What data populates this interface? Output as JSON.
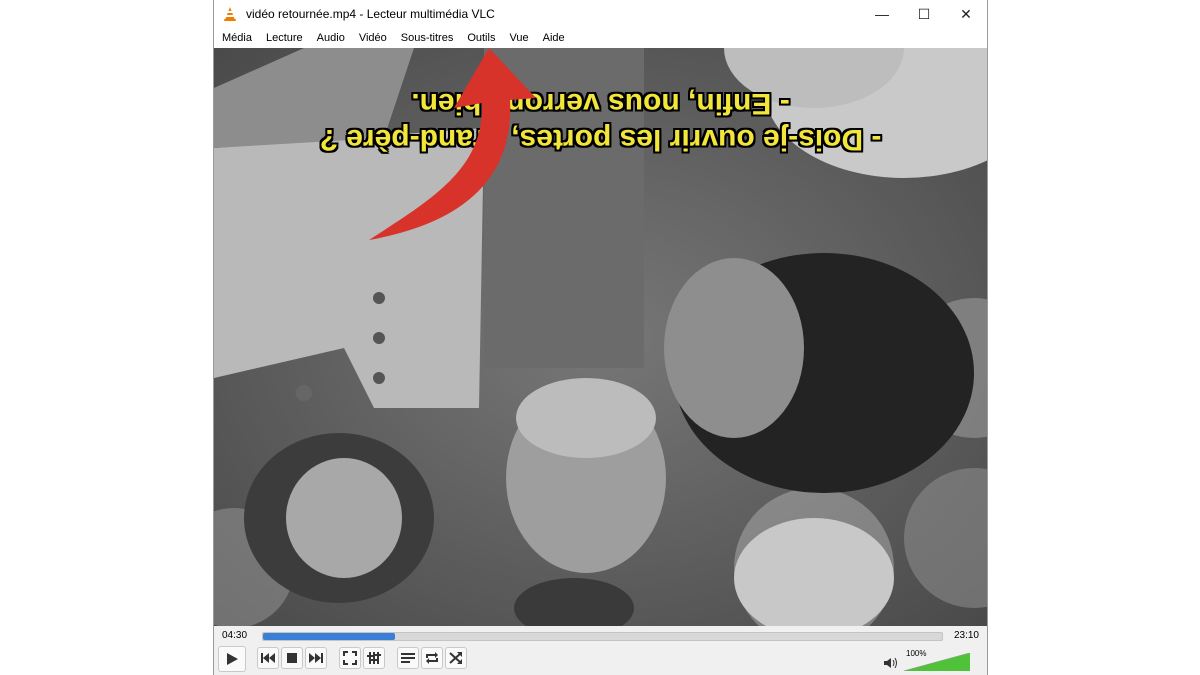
{
  "window": {
    "title": "vidéo retournée.mp4 - Lecteur multimédia VLC",
    "minimize_glyph": "—",
    "maximize_glyph": "☐",
    "close_glyph": "✕"
  },
  "menu": {
    "items": [
      "Média",
      "Lecture",
      "Audio",
      "Vidéo",
      "Sous-titres",
      "Outils",
      "Vue",
      "Aide"
    ]
  },
  "video": {
    "subtitle_line1": "- Dois-je ouvrir les portes, grand-père ?",
    "subtitle_line2": "- Enfin, nous verrons bien.",
    "orientation": "upside-down"
  },
  "annotation": {
    "type": "red-curved-arrow",
    "points_to": "Outils",
    "color": "#d8332a"
  },
  "controls": {
    "time_current": "04:30",
    "time_total": "23:10",
    "progress_fraction": 0.195,
    "volume_label": "100%",
    "volume_fraction": 1.0,
    "buttons": [
      "play-icon",
      "previous-icon",
      "stop-icon",
      "next-icon",
      "fullscreen-icon",
      "extended-settings-icon",
      "playlist-icon",
      "loop-icon",
      "shuffle-icon"
    ],
    "accent_color": "#3a7fd5"
  }
}
